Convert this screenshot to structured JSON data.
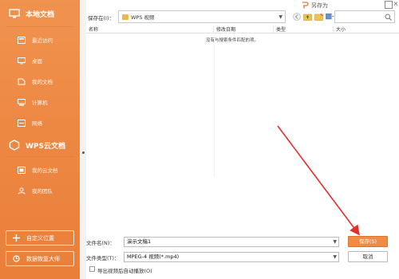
{
  "sidebar": {
    "local_docs": "本地文档",
    "items_local": [
      {
        "label": "最近访问",
        "icon": "clock-icon"
      },
      {
        "label": "桌面",
        "icon": "desktop-icon"
      },
      {
        "label": "我的文档",
        "icon": "document-icon"
      },
      {
        "label": "计算机",
        "icon": "computer-icon"
      },
      {
        "label": "网络",
        "icon": "network-icon"
      }
    ],
    "cloud_docs": "WPS云文档",
    "items_cloud": [
      {
        "label": "我的云文档",
        "icon": "cloud-doc-icon"
      },
      {
        "label": "我的团队",
        "icon": "team-icon"
      }
    ],
    "custom_location": "自定义位置",
    "data_recovery": "数据恢复大师",
    "accent": "#ed8843"
  },
  "dialog": {
    "title": "另存为"
  },
  "toolbar": {
    "save_in_label": "保存在(I)：",
    "folder": "WPS 视频",
    "search_placeholder": ""
  },
  "list": {
    "columns": [
      "名称",
      "修改日期",
      "类型",
      "大小"
    ],
    "empty_message": "没有与搜索条件匹配的项。"
  },
  "form": {
    "filename_label": "文件名(N)：",
    "filename_value": "演示文稿1",
    "filetype_label": "文件类型(T)：",
    "filetype_value": "MPEG-4 视频(*.mp4)",
    "save_button": "保存(S)",
    "cancel_button": "取消",
    "autoplay_label": "导出视频后自动播放(O)",
    "save_color": "#ef8b44",
    "arrow_color": "#e0302d"
  }
}
